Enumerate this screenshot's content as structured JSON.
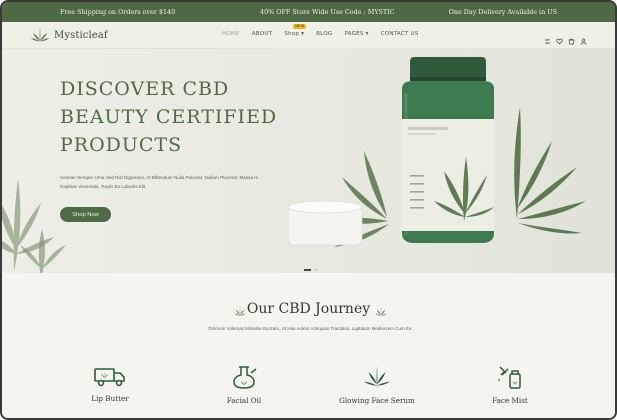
{
  "topbar": {
    "left": "Free Shipping on Orders over $140",
    "center": "40% OFF Store Wide Use Code : MYSTIC",
    "right": "One Day Delivery Available in US"
  },
  "header": {
    "logo_text": "Mysticleaf",
    "nav": [
      {
        "label": "HOME"
      },
      {
        "label": "ABOUT"
      },
      {
        "label": "Shop",
        "badge": "NEW"
      },
      {
        "label": "BLOG"
      },
      {
        "label": "PAGES"
      },
      {
        "label": "CONTACT US"
      }
    ],
    "icons": [
      "compare-icon",
      "heart-icon",
      "cart-icon",
      "user-icon"
    ]
  },
  "hero": {
    "title_lines": [
      "DISCOVER CBD",
      "BEAUTY CERTIFIED",
      "PRODUCTS"
    ],
    "text": "Aenean Semper Urna Sed Nisl Dignissim, At Bibendum Nulla Pulvinar. Nullam Placerat, Massa In Dapibus Venenatis, Turpis Ex Lobortis Elit",
    "button": "Shop Now"
  },
  "journey": {
    "title": "Our CBD Journey",
    "text": "Dolorum Volumas Molestie Ea Eam, Ut Has Autem Antiopam Tractatos, Luptatum Mediocrem Cum Eu.",
    "features": [
      {
        "label": "Lip Butter",
        "icon": "truck-icon"
      },
      {
        "label": "Facial Oil",
        "icon": "bong-icon"
      },
      {
        "label": "Glowing Face Serum",
        "icon": "cannabis-leaf-icon"
      },
      {
        "label": "Face Mist",
        "icon": "dropper-bottle-icon"
      }
    ]
  },
  "colors": {
    "brand_green": "#4f6b46",
    "topbar": "#4e6a45",
    "badge": "#e8b829",
    "background": "#f3f4ec"
  }
}
